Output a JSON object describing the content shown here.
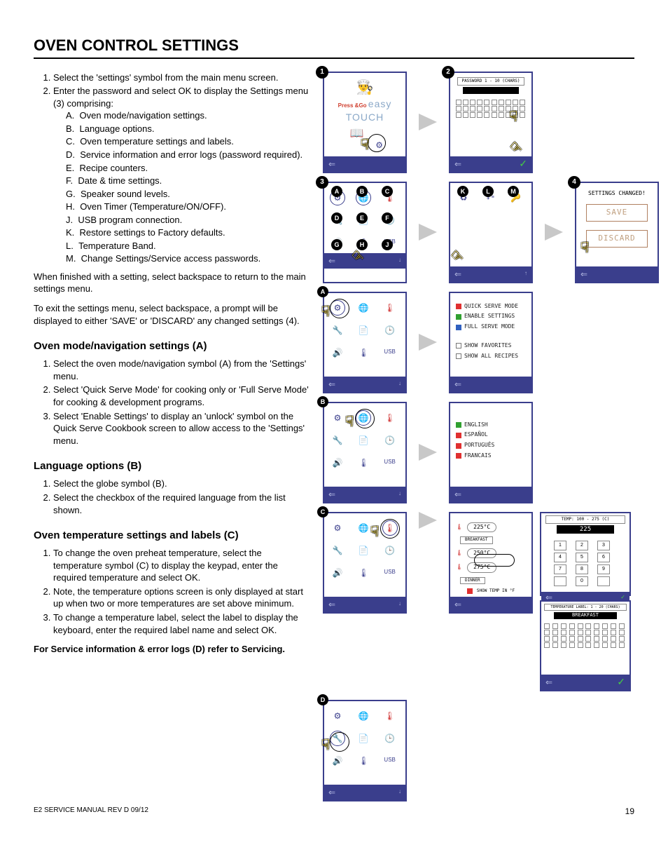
{
  "page_title": "OVEN CONTROL SETTINGS",
  "main_list": {
    "items": [
      "Select the 'settings' symbol from the main menu screen.",
      "Enter the password and select OK to display the Settings menu (3) comprising:"
    ],
    "sub": {
      "A": "Oven mode/navigation settings.",
      "B": "Language options.",
      "C": "Oven temperature settings and labels.",
      "D": "Service information and error logs (password required).",
      "E": "Recipe counters.",
      "F": "Date & time settings.",
      "G": "Speaker sound levels.",
      "H": "Oven Timer (Temperature/ON/OFF).",
      "J": "USB program connection.",
      "K": "Restore settings to Factory defaults.",
      "L": "Temperature Band.",
      "M": "Change Settings/Service access passwords."
    }
  },
  "after_list_1": "When finished with a setting, select backspace to return to the main settings menu.",
  "after_list_2": "To exit the settings menu, select backspace, a prompt will be displayed to either 'SAVE' or 'DISCARD' any changed settings (4).",
  "section_a": {
    "title": "Oven mode/navigation settings (A)",
    "items": [
      "Select the oven mode/navigation symbol (A) from the 'Settings' menu.",
      "Select 'Quick Serve Mode' for cooking only or 'Full Serve Mode' for cooking & development programs.",
      "Select 'Enable Settings' to display an 'unlock' symbol on the Quick Serve Cookbook screen to allow access to the 'Settings' menu."
    ]
  },
  "section_b": {
    "title": "Language options (B)",
    "items": [
      "Select the globe symbol (B).",
      "Select the checkbox of the required language from the list shown."
    ]
  },
  "section_c": {
    "title": "Oven temperature settings and labels (C)",
    "items": [
      "To change the oven preheat temperature, select the temperature symbol (C) to display the keypad, enter the required temperature and select OK.",
      "Note, the temperature options screen is only displayed at start up when two or more temperatures are set above minimum.",
      "To change a temperature label, select the label to display the keyboard, enter the required label name and select OK."
    ]
  },
  "bold_note": "For Service information & error logs (D) refer to Servicing.",
  "figures": {
    "panel_1_brand": "easy",
    "panel_1_brand2": "TOUCH",
    "panel_1_press": "Press &Go",
    "panel_2_header": "PASSWORD 1 - 10 (CHARS)",
    "panel_4_title": "SETTINGS CHANGED!",
    "panel_4_save": "SAVE",
    "panel_4_discard": "DISCARD",
    "mode_options": [
      "QUICK SERVE MODE",
      "ENABLE SETTINGS",
      "FULL SERVE MODE",
      "SHOW FAVORITES",
      "SHOW ALL RECIPES"
    ],
    "lang_options": [
      "ENGLISH",
      "ESPAÑOL",
      "PORTUGUÊS",
      "FRANCAIS"
    ],
    "temps": {
      "v1": "225°C",
      "l1": "BREAKFAST",
      "v2": "250°C",
      "v3": "275°C",
      "l3": "DINNER",
      "foot": "SHOW TEMP IN °F"
    },
    "keypad_top_header": "TEMP: 100 - 275 (C)",
    "keypad_top_value": "225",
    "keypad_bot_header": "TEMPERATURE LABEL: 1 - 20 (CHARS)",
    "keypad_bot_value": "BREAKFAST"
  },
  "footer_left": "E2 SERVICE MANUAL REV D 09/12",
  "footer_right": "19"
}
